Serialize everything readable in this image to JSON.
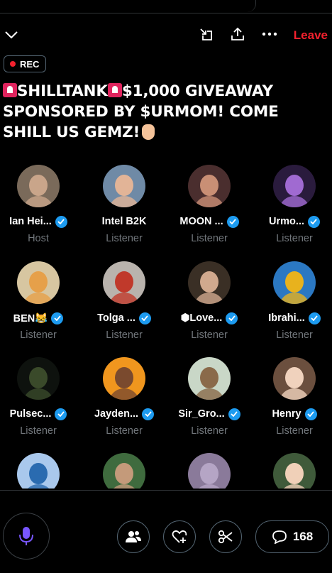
{
  "header": {
    "leave_label": "Leave",
    "icons": [
      "chevron-down-icon",
      "minimize-icon",
      "share-icon",
      "more-icon"
    ]
  },
  "rec_badge": "REC",
  "title": {
    "line1": "SHILLTANK",
    "line1b": "$1,000 GIVEAWAY",
    "line2": "SPONSORED BY $URMOM! COME",
    "line3": "SHILL US GEMZ!"
  },
  "speakers": [
    {
      "name": "Ian Hei...",
      "role": "Host",
      "verified": true,
      "color": "#7a6a5a",
      "skin": "#c9a58a"
    },
    {
      "name": "Intel B2K",
      "role": "Listener",
      "verified": false,
      "color": "#6f8aa6",
      "skin": "#e2b497"
    },
    {
      "name": "MOON ...",
      "role": "Listener",
      "verified": true,
      "color": "#4a2e2e",
      "skin": "#c98f75"
    },
    {
      "name": "Urmo...",
      "role": "Listener",
      "verified": true,
      "color": "#2a1b3d",
      "skin": "#a06ad1"
    },
    {
      "name": "BEN😹",
      "role": "Listener",
      "verified": true,
      "color": "#d7c6a1",
      "skin": "#e6a04a"
    },
    {
      "name": "Tolga ...",
      "role": "Listener",
      "verified": true,
      "color": "#b9b3ad",
      "skin": "#c0392b"
    },
    {
      "name": "⬢Love...",
      "role": "Listener",
      "verified": true,
      "color": "#3a2f25",
      "skin": "#d1a98e"
    },
    {
      "name": "Ibrahi...",
      "role": "Listener",
      "verified": true,
      "color": "#2b78c2",
      "skin": "#e8b21d"
    },
    {
      "name": "Pulsec...",
      "role": "Listener",
      "verified": true,
      "color": "#0e120e",
      "skin": "#3a4a2a"
    },
    {
      "name": "Jayden...",
      "role": "Listener",
      "verified": true,
      "color": "#f0961e",
      "skin": "#7a4a2e"
    },
    {
      "name": "Sir_Gro...",
      "role": "Listener",
      "verified": true,
      "color": "#c9d7c7",
      "skin": "#8a6a4a"
    },
    {
      "name": "Henry",
      "role": "Listener",
      "verified": true,
      "color": "#6b4f3e",
      "skin": "#f0d2bd"
    },
    {
      "name": "",
      "role": "",
      "verified": false,
      "color": "#a9c8ec",
      "skin": "#2a6bb0"
    },
    {
      "name": "",
      "role": "",
      "verified": false,
      "color": "#3f6b3e",
      "skin": "#c49a7a"
    },
    {
      "name": "",
      "role": "",
      "verified": false,
      "color": "#8a7a9a",
      "skin": "#b5a5c5"
    },
    {
      "name": "",
      "role": "",
      "verified": false,
      "color": "#3f5a3a",
      "skin": "#f0d0b8"
    }
  ],
  "footer": {
    "comment_count": "168",
    "icons": [
      "microphone-icon",
      "people-icon",
      "heart-plus-icon",
      "scissors-icon",
      "comment-icon"
    ]
  },
  "colors": {
    "accent": "#1d9bf0",
    "leave": "#f4212e",
    "muted": "#71767b",
    "mic": "#7856ff"
  }
}
